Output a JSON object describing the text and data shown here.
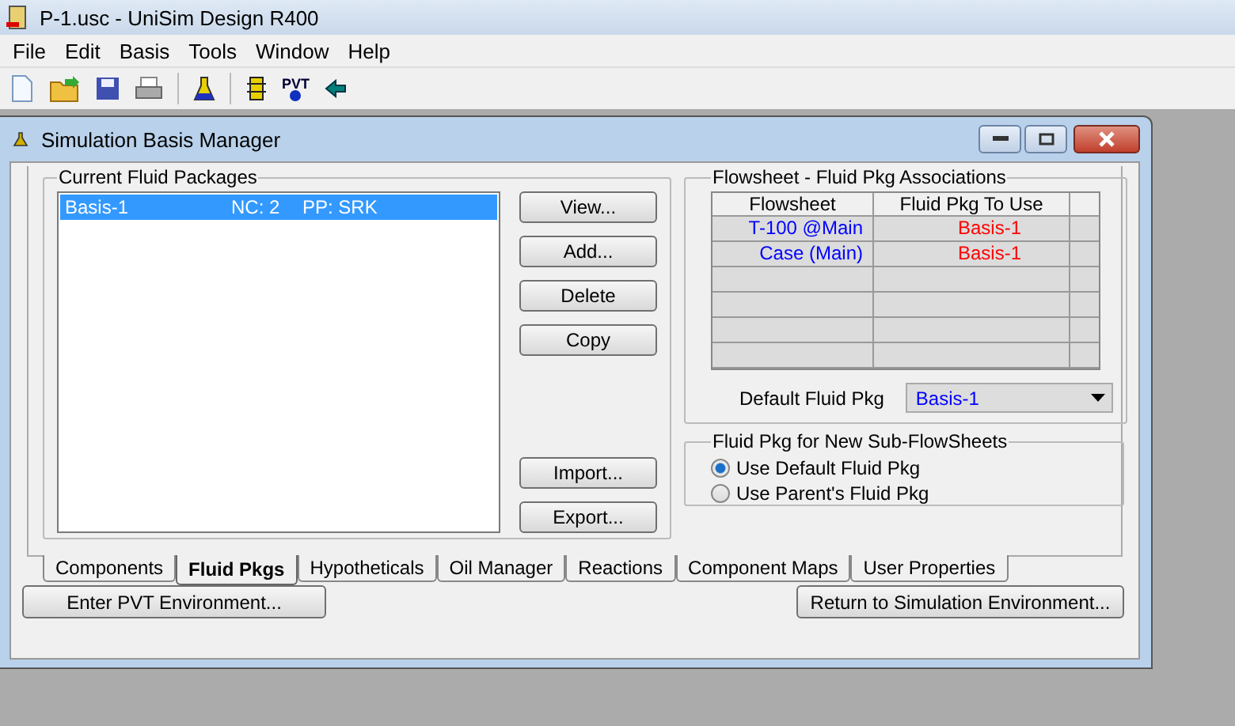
{
  "app_title": "P-1.usc - UniSim Design R400",
  "menu": [
    "File",
    "Edit",
    "Basis",
    "Tools",
    "Window",
    "Help"
  ],
  "toolbar": {
    "pvt_label": "PVT"
  },
  "window": {
    "title": "Simulation Basis Manager"
  },
  "fluid_packages": {
    "title": "Current Fluid Packages",
    "items": [
      {
        "name": "Basis-1",
        "nc": "NC: 2",
        "pp": "PP: SRK",
        "selected": true
      }
    ],
    "buttons": [
      "View...",
      "Add...",
      "Delete",
      "Copy"
    ],
    "buttons_bottom": [
      "Import...",
      "Export..."
    ]
  },
  "associations": {
    "title": "Flowsheet - Fluid Pkg Associations",
    "columns": [
      "Flowsheet",
      "Fluid Pkg To Use"
    ],
    "rows": [
      {
        "flowsheet": "T-100 @Main",
        "package": "Basis-1"
      },
      {
        "flowsheet": "Case (Main)",
        "package": "Basis-1"
      }
    ],
    "default_label": "Default Fluid Pkg",
    "default_value": "Basis-1"
  },
  "sub_flowsheets": {
    "title": "Fluid Pkg for New Sub-FlowSheets",
    "options": [
      {
        "label": "Use Default Fluid Pkg",
        "selected": true
      },
      {
        "label": "Use Parent's Fluid Pkg",
        "selected": false
      }
    ]
  },
  "tabs": [
    {
      "label": "Components",
      "selected": false
    },
    {
      "label": "Fluid Pkgs",
      "selected": true
    },
    {
      "label": "Hypotheticals",
      "selected": false
    },
    {
      "label": "Oil Manager",
      "selected": false
    },
    {
      "label": "Reactions",
      "selected": false
    },
    {
      "label": "Component Maps",
      "selected": false
    },
    {
      "label": "User Properties",
      "selected": false
    }
  ],
  "footer_buttons": [
    "Enter PVT Environment...",
    "Return to Simulation Environment..."
  ]
}
